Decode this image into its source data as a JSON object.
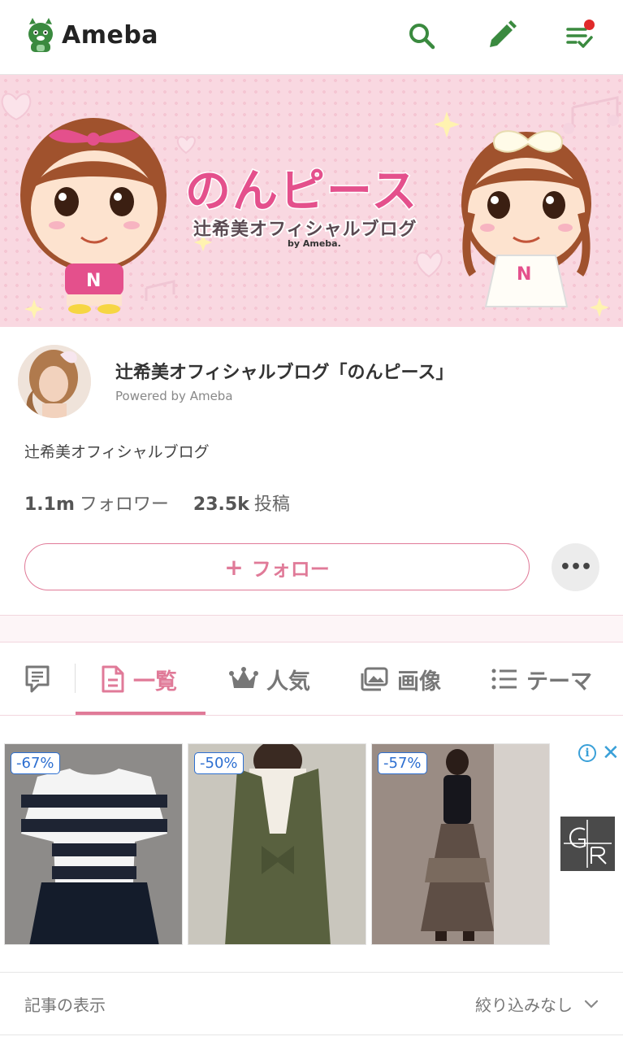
{
  "header": {
    "logo_text": "Ameba",
    "icons": [
      "search-icon",
      "pen-icon",
      "feed-check-icon"
    ],
    "accent": "#3a8a3f",
    "notification_dot": "#e02a2a"
  },
  "banner": {
    "title": "のんピース",
    "subtitle": "辻希美オフィシャルブログ",
    "by_text": "by Ameba."
  },
  "profile": {
    "blog_title": "辻希美オフィシャルブログ「のんピース」",
    "powered_by": "Powered by Ameba",
    "description": "辻希美オフィシャルブログ",
    "followers_count": "1.1m",
    "followers_label": "フォロワー",
    "posts_count": "23.5k",
    "posts_label": "投稿",
    "follow_label": "フォロー",
    "follow_plus": "+",
    "more_label": "•••"
  },
  "tabs": [
    {
      "label": "一覧",
      "icon": "document-icon",
      "active": true
    },
    {
      "label": "人気",
      "icon": "crown-icon"
    },
    {
      "label": "画像",
      "icon": "images-icon"
    },
    {
      "label": "テーマ",
      "icon": "list-icon"
    }
  ],
  "ad": {
    "items": [
      {
        "discount": "-67%"
      },
      {
        "discount": "-50%"
      },
      {
        "discount": "-57%"
      }
    ],
    "info_symbol": "i",
    "close_symbol": "✕"
  },
  "articles": {
    "label": "記事の表示",
    "filter_value": "絞り込みなし"
  }
}
